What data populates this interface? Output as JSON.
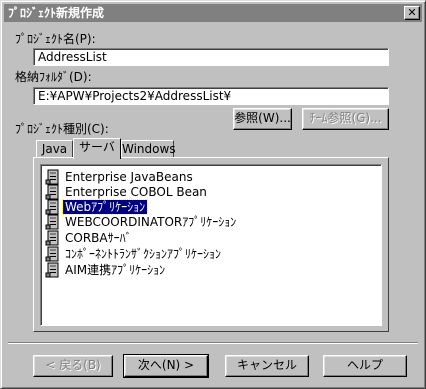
{
  "window": {
    "title": "ﾌﾟﾛｼﾞｪｸﾄ新規作成",
    "close_glyph": "✕"
  },
  "project_name": {
    "label": "ﾌﾟﾛｼﾞｪｸﾄ名(P):",
    "value": "AddressList"
  },
  "folder": {
    "label": "格納ﾌｫﾙﾀﾞ(D):",
    "value": "E:¥APW¥Projects2¥AddressList¥"
  },
  "buttons": {
    "browse": "参照(W)...",
    "team_browse": "ﾁｰﾑ参照(G)...",
    "back": "< 戻る(B)",
    "next": "次へ(N) >",
    "cancel": "キャンセル",
    "help": "ヘルプ"
  },
  "project_type": {
    "label": "ﾌﾟﾛｼﾞｪｸﾄ種別(C):"
  },
  "tabs": [
    {
      "label": "Java"
    },
    {
      "label": "サーバ"
    },
    {
      "label": "Windows"
    }
  ],
  "items": [
    {
      "label": "Enterprise JavaBeans",
      "icon": "project-icon"
    },
    {
      "label": "Enterprise COBOL Bean",
      "icon": "project-icon"
    },
    {
      "label": "Webｱﾌﾟﾘｹｰｼｮﾝ",
      "icon": "project-icon",
      "selected": true
    },
    {
      "label": "WEBCOORDINATORｱﾌﾟﾘｹｰｼｮﾝ",
      "icon": "project-icon"
    },
    {
      "label": "CORBAｻｰﾊﾞ",
      "icon": "project-icon"
    },
    {
      "label": "ｺﾝﾎﾟｰﾈﾝﾄﾄﾗﾝｻﾞｸｼｮﾝｱﾌﾟﾘｹｰｼｮﾝ",
      "icon": "project-icon"
    },
    {
      "label": "AIM連携ｱﾌﾟﾘｹｰｼｮﾝ",
      "icon": "project-icon"
    }
  ],
  "colors": {
    "selection": "#000080",
    "titlebar_inactive": "#808080",
    "face": "#c0c0c0"
  }
}
